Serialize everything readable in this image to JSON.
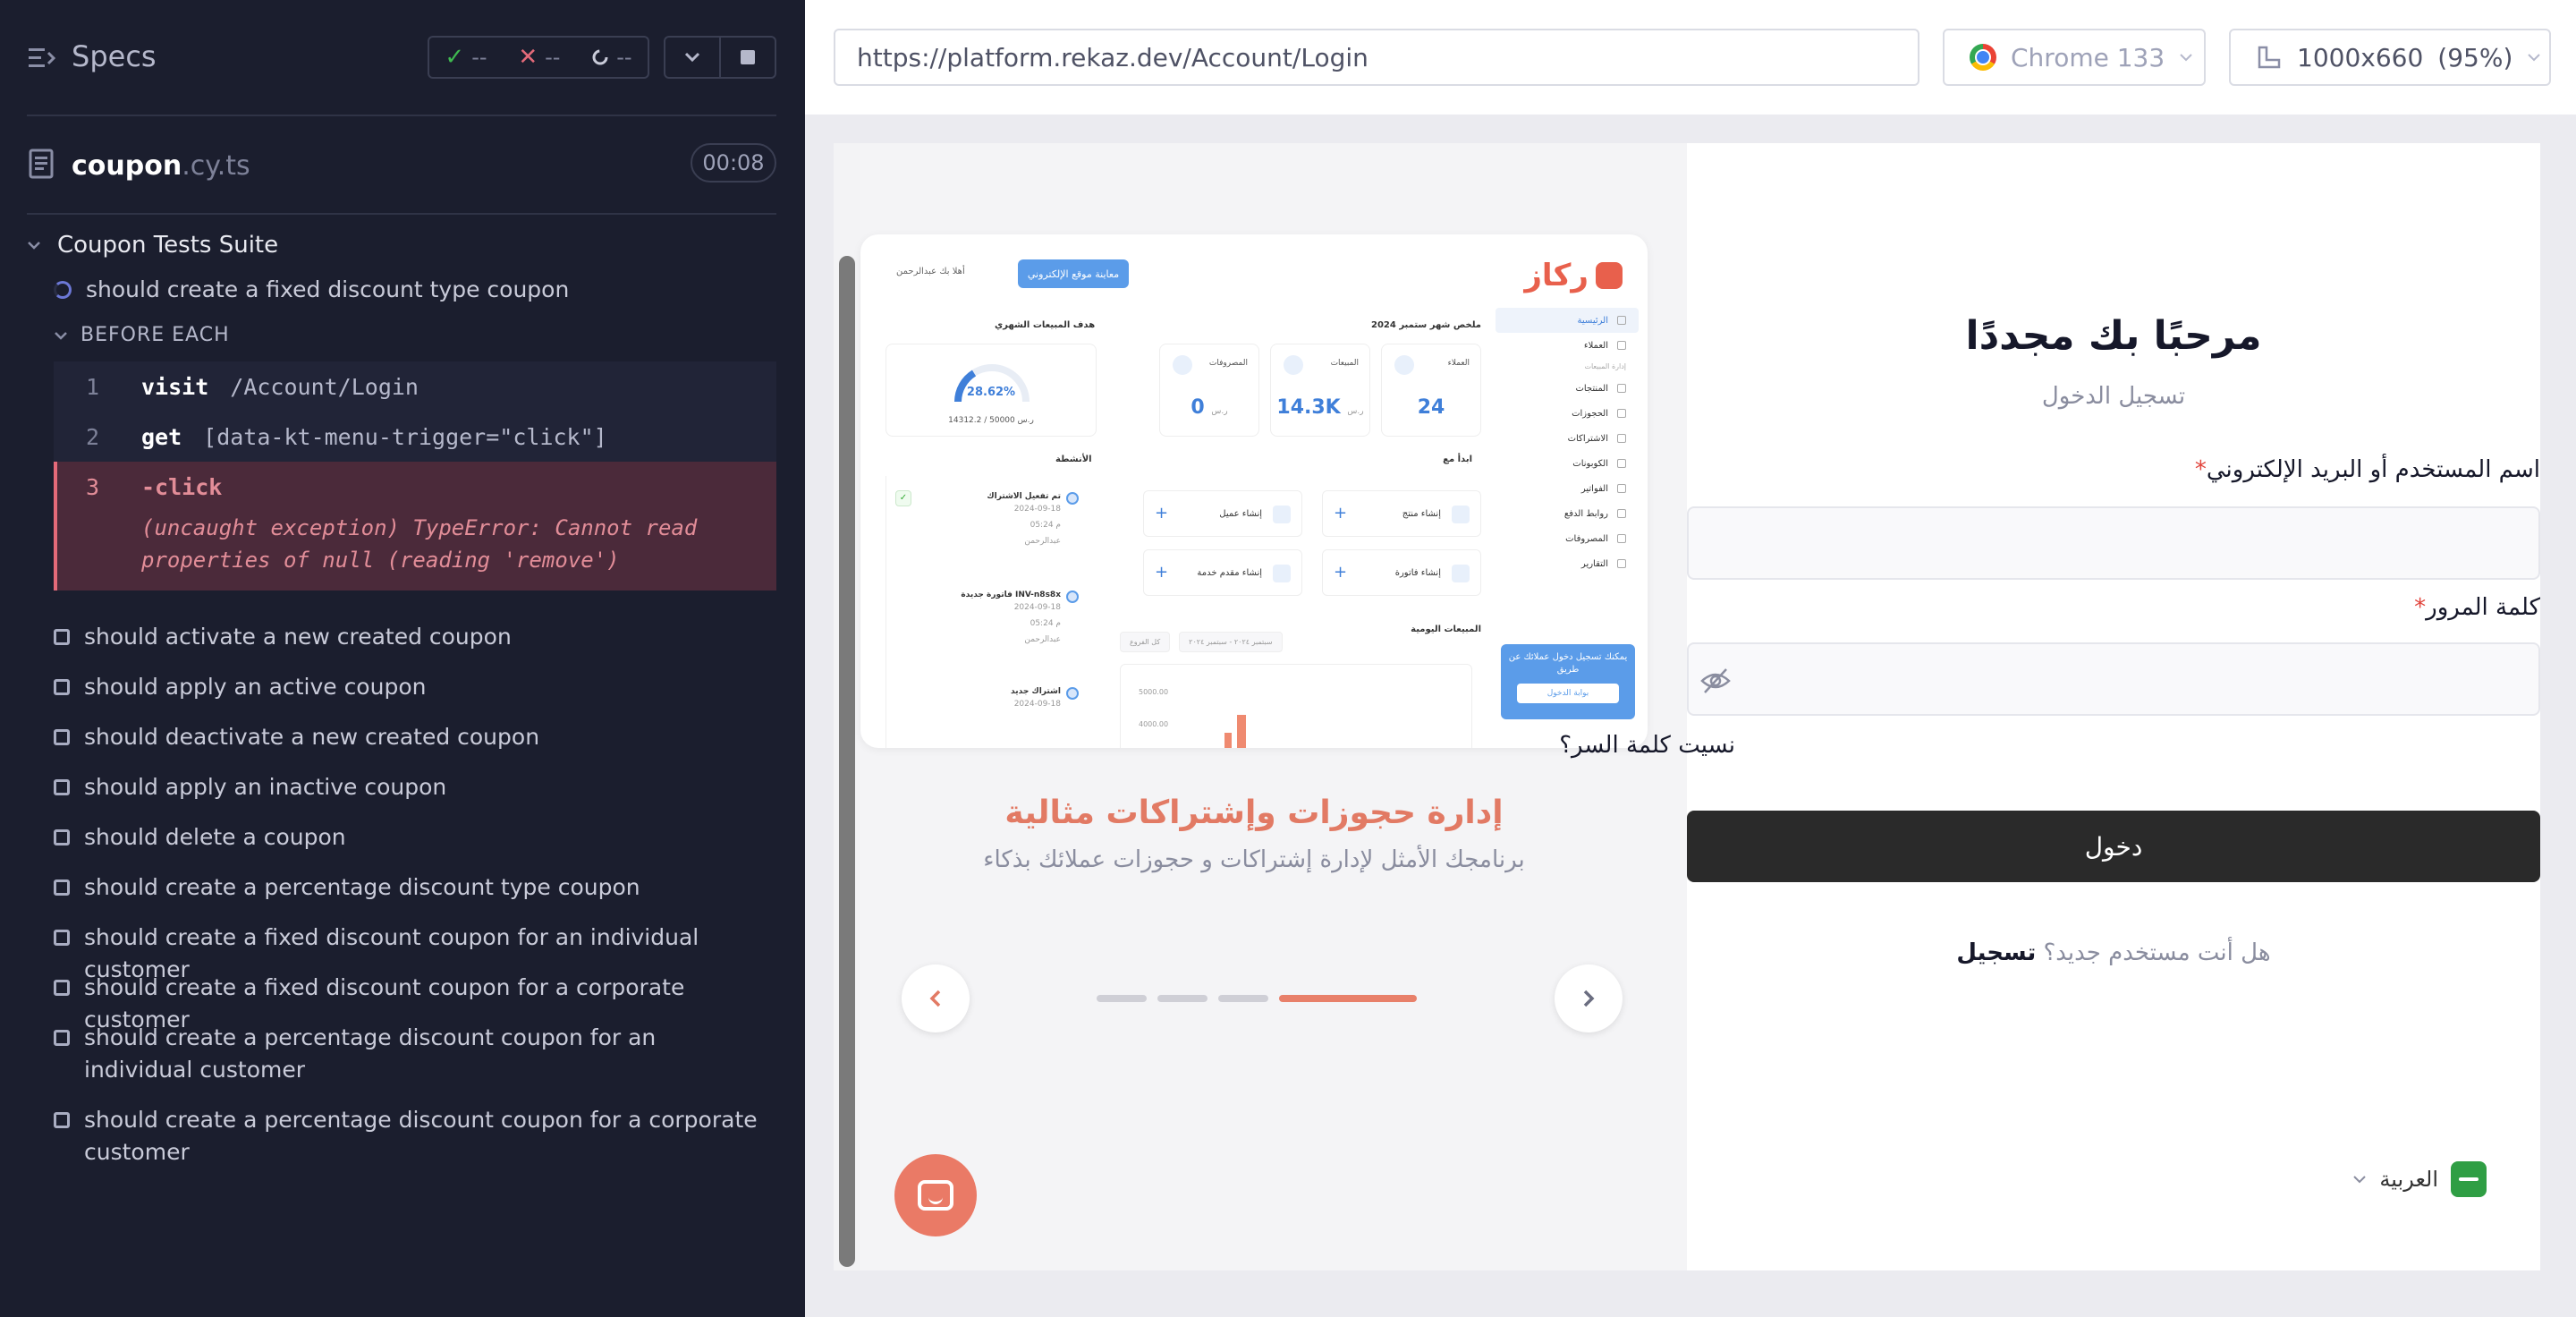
{
  "runner": {
    "title": "Specs",
    "stats": {
      "passed": "--",
      "failed": "--",
      "pending": "--"
    },
    "file": {
      "name": "coupon",
      "ext": ".cy.ts",
      "time": "00:08"
    },
    "suite": "Coupon Tests Suite",
    "current_test": "should create a fixed discount type coupon",
    "hook_label": "BEFORE EACH",
    "commands": [
      {
        "num": "1",
        "name": "visit",
        "arg": "/Account/Login"
      },
      {
        "num": "2",
        "name": "get",
        "arg": "[data-kt-menu-trigger=\"click\"]"
      },
      {
        "num": "3",
        "name": "-click",
        "error": "(uncaught exception)  TypeError: Cannot read properties of null (reading 'remove')"
      }
    ],
    "tests": [
      "should activate a new created coupon",
      "should apply an active coupon",
      "should deactivate a new created coupon",
      "should apply an inactive coupon",
      "should delete a coupon",
      "should create a percentage discount type coupon",
      "should create a fixed discount coupon for an individual customer",
      "should create a fixed discount coupon for a corporate customer",
      "should create a percentage discount coupon for an individual customer",
      "should create a percentage discount coupon for a corporate customer"
    ]
  },
  "topbar": {
    "url": "https://platform.rekaz.dev/Account/Login",
    "browser": "Chrome 133",
    "viewport": "1000x660",
    "zoom": "(95%)"
  },
  "dashboard": {
    "brand": "ركاز",
    "preview_button": "معاينة موقع الإلكتروني",
    "user": "أهلا بك عبدالرحمن",
    "sidebar": [
      "الرئيسية",
      "العملاء",
      "المنتجات",
      "الحجوزات",
      "الاشتراكات",
      "الكوبونات",
      "الفواتير",
      "روابط الدفع",
      "المصروفات",
      "التقارير"
    ],
    "sidebar_section": "إدارة المبيعات",
    "promo_text": "يمكنك تسجيل دخول عملائك عن طريق",
    "promo_button": "بوابة الدخول",
    "summary_heading": "ملخص شهر ستمبر 2024",
    "goal_heading": "هدف المبيعات الشهري",
    "stat_cards": [
      {
        "label": "العملاء",
        "value": "24",
        "unit": ""
      },
      {
        "label": "المبيعات",
        "value": "14.3K",
        "unit": "ر.س"
      },
      {
        "label": "المصروفات",
        "value": "0",
        "unit": "ر.س"
      }
    ],
    "gauge_pct": "28.62%",
    "gauge_sub": "14312.2 / 50000 ر.س",
    "start_heading": "ابدأ مع",
    "activity_heading": "الأنشطة",
    "quick_actions": [
      "إنشاء منتج",
      "إنشاء عميل",
      "إنشاء فاتورة",
      "إنشاء مقدم خدمة"
    ],
    "activities": [
      {
        "title": "تم تفعيل الاشتراك",
        "date": "2024-09-18",
        "time": "05:24 م",
        "who": "عبدالرحمن"
      },
      {
        "title": "فاتورة جديدة INV-n8s8x",
        "date": "2024-09-18",
        "time": "05:24 م",
        "who": "عبدالرحمن"
      },
      {
        "title": "اشتراك جديد",
        "date": "2024-09-18",
        "time": "",
        "who": ""
      }
    ],
    "daily_heading": "المبيعات اليومية",
    "chart_filter_date": "سبتمبر ٢٠٢٤ - سبتمبر ٢٠٢٤",
    "chart_filter_branch": "كل الفروع",
    "chart_ticks": [
      "5000.00",
      "4000.00"
    ]
  },
  "slide": {
    "title": "إدارة حجوزات وإشتراكات مثالية",
    "subtitle": "برنامجك الأمثل لإدارة إشتراكات و حجوزات عملائك بذكاء",
    "active_index": 3,
    "count": 4
  },
  "login": {
    "title": "مرحبًا بك مجددًا",
    "subtitle": "تسجيل الدخول",
    "username_label": "اسم المستخدم أو البريد الإلكتروني",
    "password_label": "كلمة المرور",
    "required_mark": "*",
    "forgot": "نسيت كلمة السر؟",
    "submit": "دخول",
    "register_question": "هل أنت مستخدم جديد؟",
    "register_link": "تسجيل",
    "language": "العربية"
  }
}
